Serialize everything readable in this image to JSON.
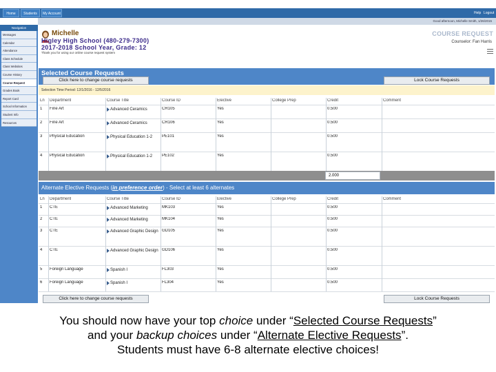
{
  "topbar": {
    "tabs": [
      "Home",
      "Students",
      "My Account"
    ],
    "help": "Help",
    "logout": "Logout"
  },
  "userbar": {
    "text": "Good afternoon, Michelle Smith, 1/26/2015"
  },
  "sidebar": {
    "header": "Navigation",
    "items": [
      "Messages",
      "Calendar",
      "Attendance",
      "Class Schedule",
      "Class Websites",
      "Course History",
      "Course Request",
      "Grades Book",
      "Report Card",
      "School Information",
      "Student Info",
      "Resources"
    ],
    "active_index": 6
  },
  "student": {
    "name": "Michelle",
    "school": "Higley High School (480-279-7300)",
    "year": "2017-2018 School Year, Grade: 12",
    "note": "Thank you for using our online course request system"
  },
  "course_request": {
    "title": "COURSE REQUEST",
    "counselor": "Counselor: Fan Harris"
  },
  "selected": {
    "title": "Selected Course Requests",
    "change_button": "Click here to change course requests",
    "lock_button": "Lock Course Requests",
    "period": "Selection Time Period: 12/1/2016 - 12/5/2016",
    "columns": [
      "Ln",
      "Department",
      "Course Title",
      "Course ID",
      "Elective",
      "College Prep",
      "Credit",
      "Comment"
    ],
    "rows": [
      {
        "ln": "1",
        "dept": "Fine Art",
        "title": "Advanced Ceramics",
        "id": "CR105",
        "elective": "Yes",
        "prep": "",
        "credit": "0.500",
        "comment": ""
      },
      {
        "ln": "2",
        "dept": "Fine Art",
        "title": "Advanced Ceramics",
        "id": "CR106",
        "elective": "Yes",
        "prep": "",
        "credit": "0.500",
        "comment": ""
      },
      {
        "ln": "3",
        "dept": "Physical Education",
        "title": "Physical Education 1-2",
        "id": "PE101",
        "elective": "Yes",
        "prep": "",
        "credit": "0.500",
        "comment": ""
      },
      {
        "ln": "4",
        "dept": "Physical Education",
        "title": "Physical Education 1-2",
        "id": "PE102",
        "elective": "Yes",
        "prep": "",
        "credit": "0.500",
        "comment": ""
      }
    ],
    "total": "2.000"
  },
  "alternate": {
    "title_pre": "Alternate Elective Requests (",
    "title_em": "in preference order",
    "title_post": ") - Select at least 6 alternates",
    "columns": [
      "Ln",
      "Department",
      "Course Title",
      "Course ID",
      "Elective",
      "College Prep",
      "Credit",
      "Comment"
    ],
    "rows": [
      {
        "ln": "1",
        "dept": "CTE",
        "title": "Advanced Marketing",
        "id": "MK103",
        "elective": "Yes",
        "prep": "",
        "credit": "0.500",
        "comment": ""
      },
      {
        "ln": "2",
        "dept": "CTE",
        "title": "Advanced Marketing",
        "id": "MK104",
        "elective": "Yes",
        "prep": "",
        "credit": "0.500",
        "comment": ""
      },
      {
        "ln": "3",
        "dept": "CTE",
        "title": "Advanced Graphic Design",
        "id": "GD105",
        "elective": "Yes",
        "prep": "",
        "credit": "0.500",
        "comment": ""
      },
      {
        "ln": "4",
        "dept": "CTE",
        "title": "Advanced Graphic Design",
        "id": "GD106",
        "elective": "Yes",
        "prep": "",
        "credit": "0.500",
        "comment": ""
      },
      {
        "ln": "5",
        "dept": "Foreign Language",
        "title": "Spanish I",
        "id": "FL303",
        "elective": "Yes",
        "prep": "",
        "credit": "0.500",
        "comment": ""
      },
      {
        "ln": "6",
        "dept": "Foreign Language",
        "title": "Spanish I",
        "id": "FL304",
        "elective": "Yes",
        "prep": "",
        "credit": "0.500",
        "comment": ""
      }
    ],
    "change_button": "Click here to change course requests",
    "lock_button": "Lock Course Requests"
  },
  "caption": {
    "l1_a": "You should now have your top ",
    "l1_b": "choice",
    "l1_c": " under “",
    "l1_d": "Selected Course Requests",
    "l1_e": "”",
    "l2_a": "and your ",
    "l2_b": "backup choices",
    "l2_c": " under “",
    "l2_d": "Alternate Elective Requests",
    "l2_e": "”.",
    "l3": "Students must have 6-8 alternate elective choices!"
  },
  "colors": {
    "brand": "#2f6aa8",
    "section": "#4e86c8",
    "period_bg": "#fdf3cc"
  }
}
